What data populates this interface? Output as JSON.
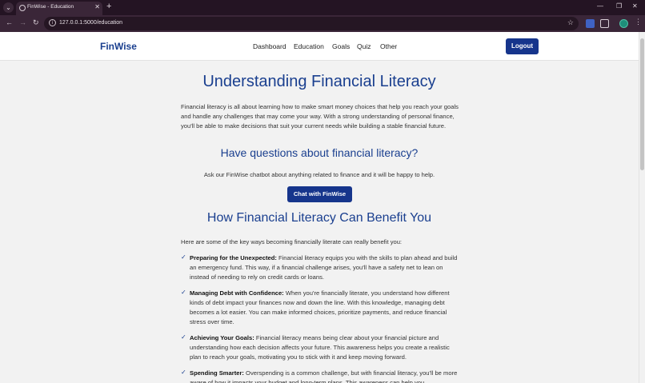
{
  "browser": {
    "tab_title": "FinWise - Education",
    "url": "127.0.0.1:5000/education"
  },
  "header": {
    "brand": "FinWise",
    "nav": [
      "Dashboard",
      "Education",
      "Goals",
      "Quiz",
      "Other"
    ],
    "logout": "Logout"
  },
  "main": {
    "title": "Understanding Financial Literacy",
    "intro": "Financial literacy is all about learning how to make smart money choices that help you reach your goals and handle any challenges that may come your way. With a strong understanding of personal finance, you'll be able to make decisions that suit your current needs while building a stable financial future.",
    "questions_heading": "Have questions about financial literacy?",
    "questions_text": "Ask our FinWise chatbot about anything related to finance and it will be happy to help.",
    "chat_button": "Chat with FinWise",
    "benefits_heading": "How Financial Literacy Can Benefit You",
    "benefits_intro": "Here are some of the key ways becoming financially literate can really benefit you:",
    "check_symbol": "✓",
    "benefits": [
      {
        "title": "Preparing for the Unexpected:",
        "text": " Financial literacy equips you with the skills to plan ahead and build an emergency fund. This way, if a financial challenge arises, you'll have a safety net to lean on instead of needing to rely on credit cards or loans."
      },
      {
        "title": "Managing Debt with Confidence:",
        "text": " When you're financially literate, you understand how different kinds of debt impact your finances now and down the line. With this knowledge, managing debt becomes a lot easier. You can make informed choices, prioritize payments, and reduce financial stress over time."
      },
      {
        "title": "Achieving Your Goals:",
        "text": " Financial literacy means being clear about your financial picture and understanding how each decision affects your future. This awareness helps you create a realistic plan to reach your goals, motivating you to stick with it and keep moving forward."
      },
      {
        "title": "Spending Smarter:",
        "text": " Overspending is a common challenge, but with financial literacy, you'll be more aware of how it impacts your budget and long-term plans. This awareness can help you"
      }
    ]
  },
  "colors": {
    "accent": "#1a3f8f",
    "button": "#16358c",
    "chrome": "#3a2638"
  }
}
